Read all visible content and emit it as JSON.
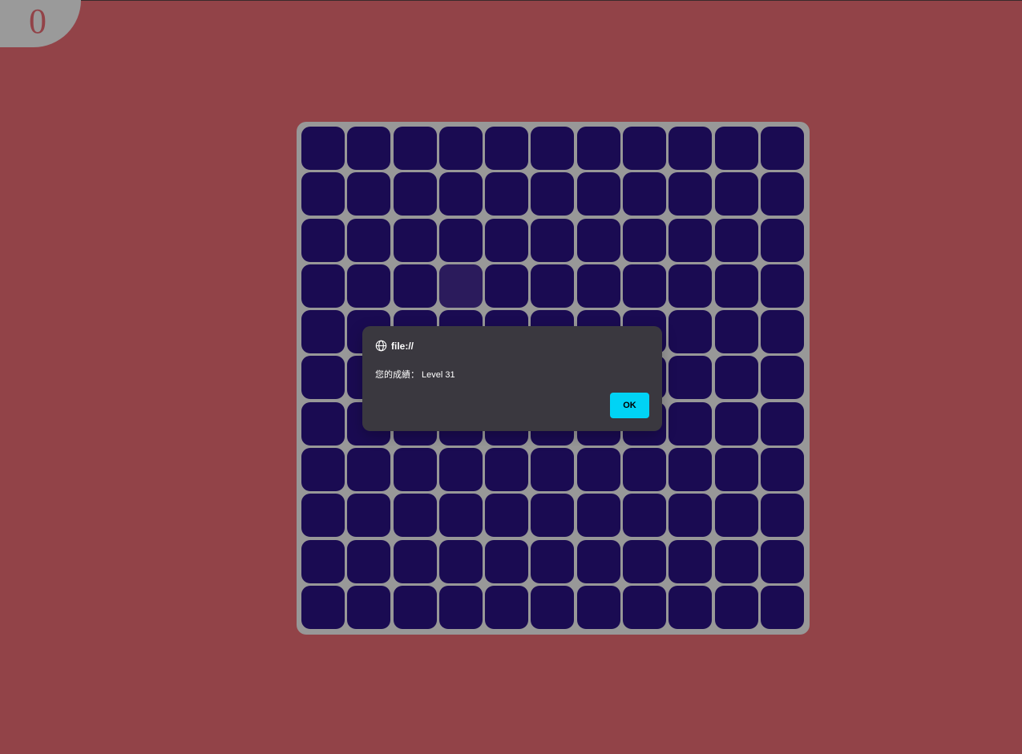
{
  "score": {
    "value": "0"
  },
  "board": {
    "rows": 11,
    "cols": 11,
    "odd_tile": {
      "row": 3,
      "col": 3
    },
    "colors": {
      "tile": "#1a0b52",
      "odd_tile": "#2b1b5c",
      "board_bg": "#989898",
      "page_bg": "#924348"
    }
  },
  "dialog": {
    "origin": "file://",
    "message": "您的成績： Level  31",
    "ok_label": "OK",
    "icon": "globe-icon"
  }
}
